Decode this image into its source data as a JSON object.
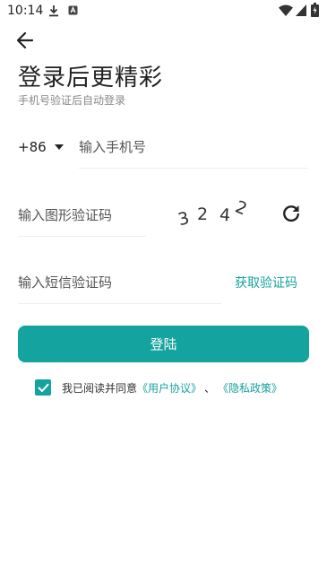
{
  "status_bar": {
    "time": "10:14",
    "icons": [
      "download-icon",
      "app-notification-icon",
      "wifi-icon",
      "cellular-signal-icon",
      "battery-charging-icon"
    ]
  },
  "header": {
    "back_icon": "arrow-left-icon",
    "title": "登录后更精彩",
    "subtitle": "手机号验证后自动登录"
  },
  "phone": {
    "country_code": "+86",
    "placeholder": "输入手机号"
  },
  "captcha": {
    "placeholder": "输入图形验证码",
    "image_text": "3242",
    "refresh_icon": "refresh-icon"
  },
  "sms": {
    "placeholder": "输入短信验证码",
    "get_code_label": "获取验证码"
  },
  "login_button_label": "登陆",
  "agreement": {
    "checked": true,
    "prefix": "我已阅读并同意",
    "user_agreement": "《用户协议》",
    "separator": "、",
    "privacy_policy": "《隐私政策》"
  },
  "colors": {
    "accent": "#14a39f",
    "link": "#16a39e"
  }
}
